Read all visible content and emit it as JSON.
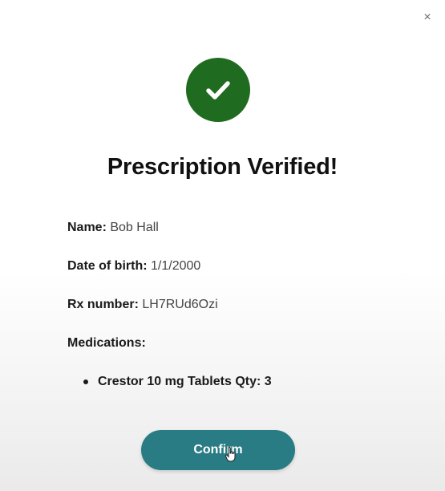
{
  "modal": {
    "close_glyph": "×",
    "title": "Prescription Verified!",
    "status_icon": "check-icon",
    "accent_color": "#1f6b1f",
    "button_color": "#2a7c84"
  },
  "patient": {
    "name_label": "Name:",
    "name_value": "Bob Hall",
    "dob_label": "Date of birth:",
    "dob_value": "1/1/2000",
    "rx_label": "Rx number:",
    "rx_value": "LH7RUd6Ozi",
    "medications_label": "Medications:",
    "medications": [
      {
        "text": "Crestor 10 mg Tablets Qty: 3"
      }
    ]
  },
  "actions": {
    "confirm_label": "Confirm"
  }
}
